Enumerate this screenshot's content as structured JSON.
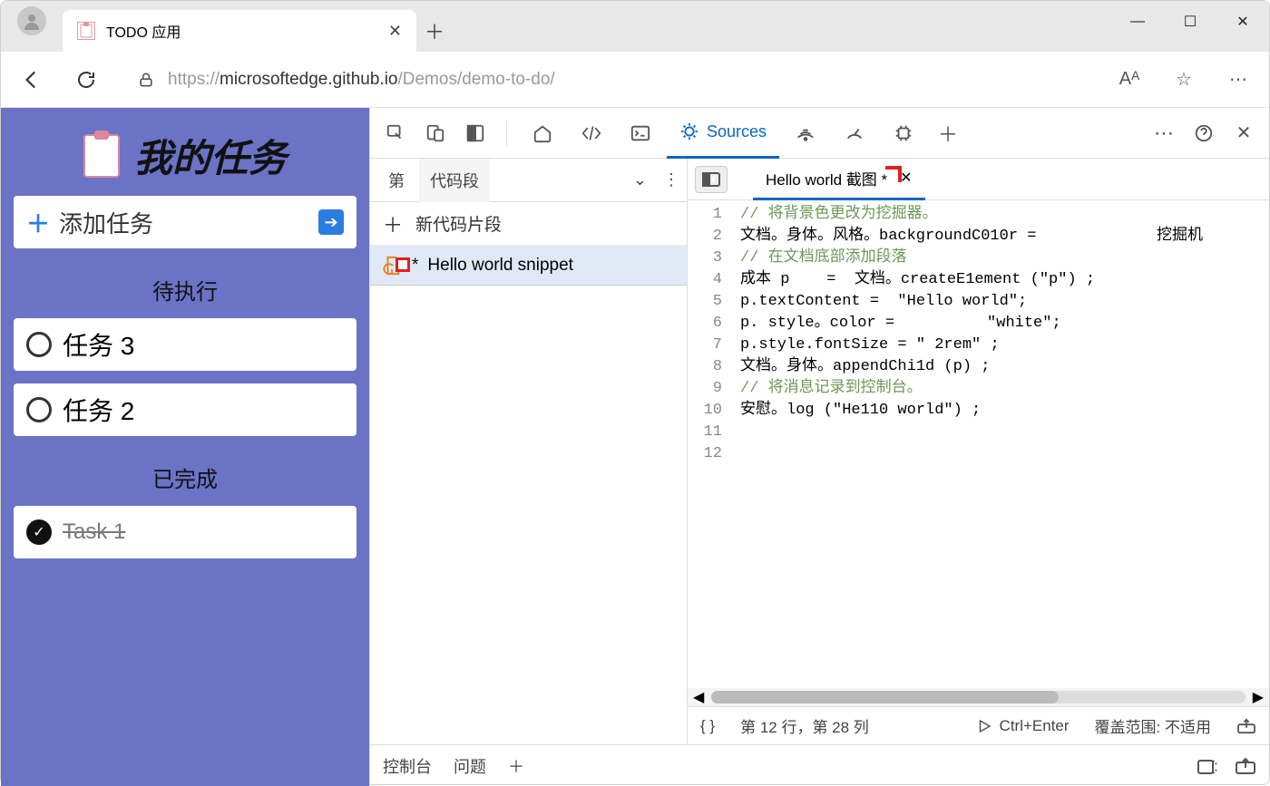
{
  "window": {
    "minimize": "—",
    "maximize": "☐",
    "close": "✕"
  },
  "tab": {
    "title": "TODO 应用",
    "close": "✕"
  },
  "address": {
    "lock": "🔒",
    "url_prefix": "https://",
    "url_host": "microsoftedge.github.io",
    "url_path": "/Demos/demo-to-do/",
    "reader": "Aᴬ",
    "star": "☆",
    "more": "⋯"
  },
  "page": {
    "title": "我的任务",
    "add_label": "添加任务",
    "add_plus": "＋",
    "pending_header": "待执行",
    "done_header": "已完成",
    "tasks_pending": [
      "任务 3",
      "任务 2"
    ],
    "tasks_done": [
      "Task 1"
    ]
  },
  "devtools": {
    "tabs": {
      "sources": "Sources"
    },
    "more": "⋯",
    "close": "✕",
    "plus": "＋"
  },
  "snippets": {
    "tab1": "第",
    "tab2": "代码段",
    "chevron": "⌄",
    "more": "⋮",
    "new_label": "新代码片段",
    "item_prefix": "*",
    "item_name": "Hello world snippet"
  },
  "editor": {
    "tab_name": "Hello world 截图 *",
    "tab_close": "✕",
    "lines": [
      "// 将背景色更改为挖掘器。",
      "文档。身体。风格。backgroundC010r =             挖掘机",
      "",
      "// 在文档底部添加段落",
      "成本 p    =  文档。createE1ement (\"p\") ;",
      "p.textContent =  \"Hello world\";",
      "p. style。color =          \"white\";",
      "p.style.fontSize = \" 2rem\" ;",
      "文档。身体。appendChi1d (p) ;",
      "",
      "// 将消息记录到控制台。",
      "安慰。log (\"He110 world\") ;"
    ],
    "status_braces": "{ }",
    "status_pos": "第 12 行，第 28 列",
    "status_run": "Ctrl+Enter",
    "status_coverage": "覆盖范围: 不适用"
  },
  "drawer": {
    "console": "控制台",
    "issues": "问题",
    "plus": "＋"
  }
}
